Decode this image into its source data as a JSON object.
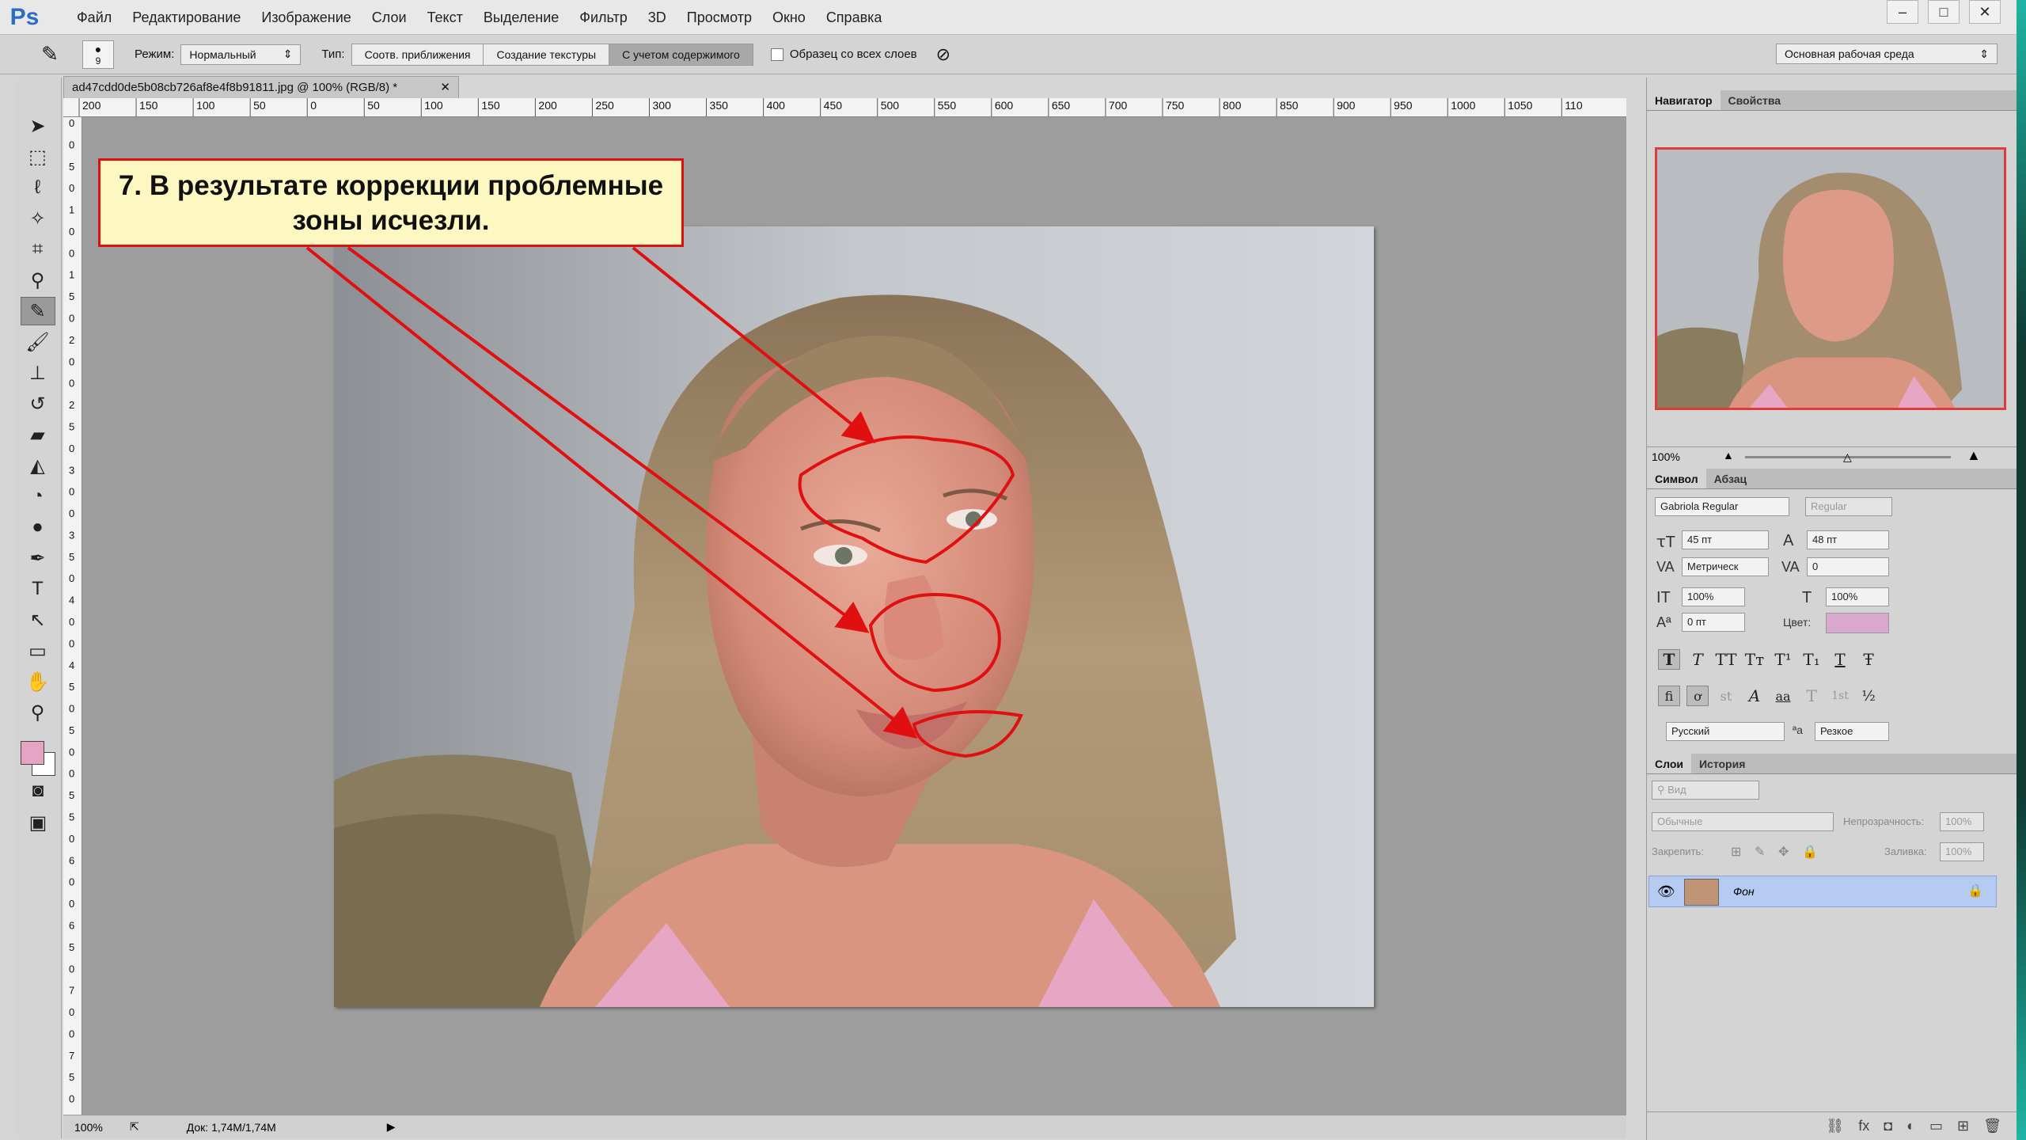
{
  "app": {
    "logo": "Ps"
  },
  "menu": [
    "Файл",
    "Редактирование",
    "Изображение",
    "Слои",
    "Текст",
    "Выделение",
    "Фильтр",
    "3D",
    "Просмотр",
    "Окно",
    "Справка"
  ],
  "window_controls": {
    "minimize": "‒",
    "maximize": "□",
    "close": "✕"
  },
  "options": {
    "brush_size": "9",
    "mode_label": "Режим:",
    "mode_value": "Нормальный",
    "type_label": "Тип:",
    "type_options": [
      "Соотв. приближения",
      "Создание текстуры",
      "С учетом содержимого"
    ],
    "type_selected": "С учетом содержимого",
    "sample_all_label": "Образец со всех слоев",
    "workspace": "Основная рабочая среда"
  },
  "document": {
    "tab_title": "ad47cdd0de5b08cb726af8e4f8b91811.jpg @ 100% (RGB/8) *",
    "ruler_h": [
      "200",
      "150",
      "100",
      "50",
      "0",
      "50",
      "100",
      "150",
      "200",
      "250",
      "300",
      "350",
      "400",
      "450",
      "500",
      "550",
      "600",
      "650",
      "700",
      "750",
      "800",
      "850",
      "900",
      "950",
      "1000",
      "1050",
      "110"
    ],
    "ruler_v": [
      "0",
      "0",
      "5",
      "0",
      "1",
      "0",
      "0",
      "1",
      "5",
      "0",
      "2",
      "0",
      "0",
      "2",
      "5",
      "0",
      "3",
      "0",
      "0",
      "3",
      "5",
      "0",
      "4",
      "0",
      "0",
      "4",
      "5",
      "0",
      "5",
      "0",
      "0",
      "5",
      "5",
      "0",
      "6",
      "0",
      "0",
      "6",
      "5",
      "0",
      "7",
      "0",
      "0",
      "7",
      "5",
      "0"
    ],
    "zoom": "100%",
    "doc_info": "Док: 1,74M/1,74M"
  },
  "annotation": {
    "text_line1": "7. В результате коррекции проблемные",
    "text_line2": "зоны исчезли."
  },
  "navigator": {
    "tabs": [
      "Навигатор",
      "Свойства"
    ],
    "zoom": "100%"
  },
  "character": {
    "tabs": [
      "Символ",
      "Абзац"
    ],
    "font_family": "Gabriola Regular",
    "font_style": "Regular",
    "font_size": "45 пт",
    "leading": "48 пт",
    "kerning": "Метрическ",
    "tracking": "0",
    "vertical_scale": "100%",
    "horizontal_scale": "100%",
    "baseline_shift": "0 пт",
    "color_label": "Цвет:",
    "color": "#d9a8cf",
    "language": "Русский",
    "antialias_label": "ªa",
    "antialias": "Резкое",
    "format_row1": [
      "T",
      "T",
      "TT",
      "Tт",
      "T¹",
      "T₁",
      "T",
      "Ŧ"
    ],
    "format_row2": [
      "fi",
      "ơ",
      "st",
      "A",
      "aa",
      "T",
      "1st",
      "½"
    ]
  },
  "layers": {
    "tabs": [
      "Слои",
      "История"
    ],
    "filter_placeholder": "Вид",
    "blend_mode": "Обычные",
    "opacity_label": "Непрозрачность:",
    "opacity": "100%",
    "lock_label": "Закрепить:",
    "fill_label": "Заливка:",
    "fill": "100%",
    "items": [
      {
        "name": "Фон"
      }
    ]
  }
}
